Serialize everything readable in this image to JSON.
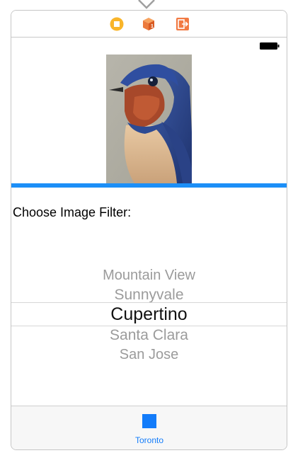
{
  "filter_label": "Choose Image Filter:",
  "picker": {
    "items": [
      "Mountain View",
      "Sunnyvale",
      "Cupertino",
      "Santa Clara",
      "San Jose"
    ],
    "selected": "Cupertino"
  },
  "tab_bar": {
    "items": [
      {
        "label": "Toronto",
        "icon": "square-icon"
      }
    ]
  },
  "dock_icons": [
    "view-controller-icon",
    "first-responder-icon",
    "exit-icon"
  ],
  "progress": 1.0,
  "colors": {
    "accent": "#137cfa",
    "progress": "#1c8ff7",
    "picker_text": "#9b9b9b",
    "picker_selected": "#111111"
  }
}
